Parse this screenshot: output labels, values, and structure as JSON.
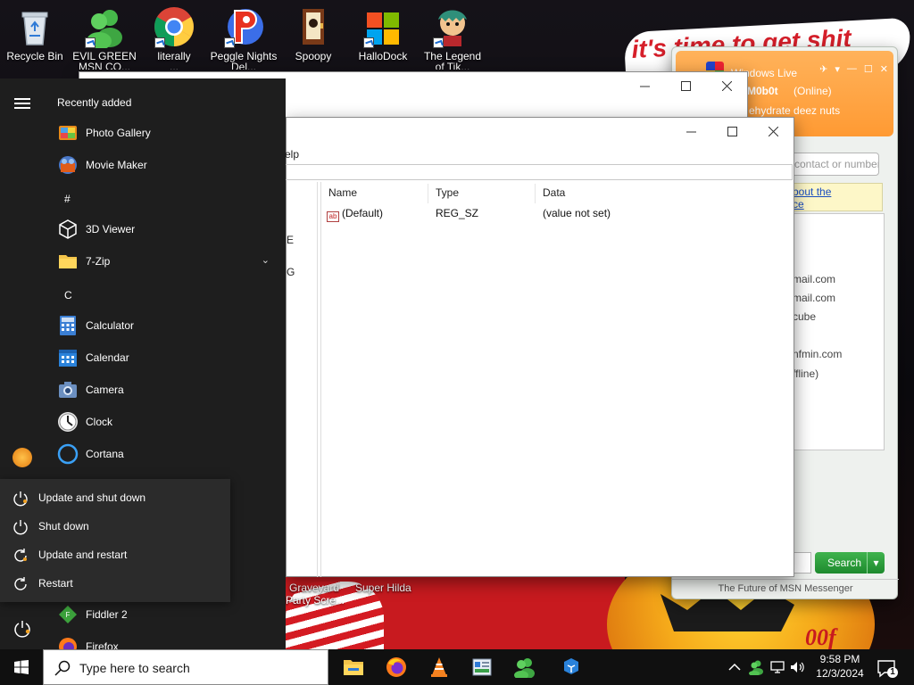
{
  "desktop": {
    "icons": [
      {
        "label": "Recycle Bin",
        "label2": ""
      },
      {
        "label": "EVIL GREEN",
        "label2": "MSN CO..."
      },
      {
        "label": "literally",
        "label2": "..."
      },
      {
        "label": "Peggle Nights",
        "label2": "Del..."
      },
      {
        "label": "Spoopy",
        "label2": ""
      },
      {
        "label": "HalloDock",
        "label2": ""
      },
      {
        "label": "The Legend",
        "label2": "of Tik..."
      }
    ],
    "wallpaper_text": "it's time to get shit",
    "wallpaper_pumpkin_text": "00f",
    "behind_icons": [
      {
        "label": "Graveyard",
        "label2": "Party Scre..."
      },
      {
        "label": "Super Hilda",
        "label2": ""
      }
    ]
  },
  "back_window": {
    "controls": {
      "minimize": "—",
      "maximize": "☐",
      "close": "✕"
    }
  },
  "regedit": {
    "title_fragment": "P G I",
    "menu_fragment": "elp",
    "tree_items": [
      "E",
      "G"
    ],
    "columns": [
      "Name",
      "Type",
      "Data"
    ],
    "rows": [
      {
        "name": "(Default)",
        "type": "REG_SZ",
        "data": "(value not set)"
      }
    ]
  },
  "messenger": {
    "title": "Windows Live",
    "user": "M0b0t",
    "status": "(Online)",
    "personal_message": "ehydrate deez nuts",
    "search_placeholder": "contact or number",
    "ad_line1": "bout the",
    "ad_line2": "ce",
    "contacts": [
      "mail.com",
      "mail.com",
      "cube",
      "nfmin.com",
      "ffline)"
    ],
    "search_button": "Search",
    "footer": "The Future of MSN Messenger"
  },
  "start_menu": {
    "header": "Recently added",
    "recent": [
      {
        "label": "Photo Gallery",
        "icon": "photo-gallery-icon"
      },
      {
        "label": "Movie Maker",
        "icon": "movie-maker-icon"
      }
    ],
    "groups": [
      {
        "letter": "#",
        "apps": [
          {
            "label": "3D Viewer",
            "icon": "3d-viewer-icon"
          },
          {
            "label": "7-Zip",
            "icon": "folder-icon",
            "expandable": true
          }
        ]
      },
      {
        "letter": "C",
        "apps": [
          {
            "label": "Calculator",
            "icon": "calculator-icon"
          },
          {
            "label": "Calendar",
            "icon": "calendar-icon"
          },
          {
            "label": "Camera",
            "icon": "camera-icon"
          },
          {
            "label": "Clock",
            "icon": "clock-icon"
          },
          {
            "label": "Cortana",
            "icon": "cortana-icon"
          }
        ]
      }
    ],
    "after_power": [
      {
        "label": "Fiddler 2",
        "icon": "fiddler-icon"
      },
      {
        "label": "Firefox",
        "icon": "firefox-icon"
      }
    ],
    "power_menu": [
      {
        "label": "Update and shut down",
        "icon": "update-power-icon"
      },
      {
        "label": "Shut down",
        "icon": "power-icon"
      },
      {
        "label": "Update and restart",
        "icon": "update-restart-icon"
      },
      {
        "label": "Restart",
        "icon": "restart-icon"
      }
    ]
  },
  "taskbar": {
    "search_placeholder": "Type here to search",
    "time": "9:58 PM",
    "date": "12/3/2024",
    "notification_count": "1"
  },
  "colors": {
    "start_bg": "#1e1e1e",
    "power_menu_bg": "#2b2b2b",
    "taskbar_bg": "#101010",
    "msn_orange": "#ff9a33",
    "msn_green": "#2ea23c"
  }
}
